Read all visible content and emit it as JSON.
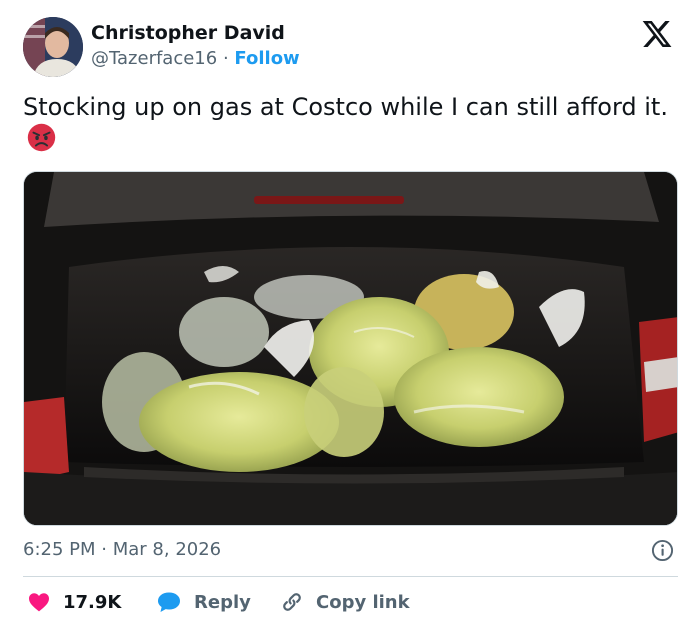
{
  "author": {
    "display_name": "Christopher David",
    "handle": "@Tazerface16",
    "separator": "·",
    "follow_label": "Follow"
  },
  "tweet": {
    "text": "Stocking up on gas at Costco while I can still afford it.",
    "emoji": "angry-face-emoji",
    "time": "6:25 PM",
    "date_separator": "·",
    "date": "Mar 8, 2026"
  },
  "actions": {
    "likes_count": "17.9K",
    "reply_label": "Reply",
    "copy_link_label": "Copy link"
  },
  "icons": {
    "platform": "x-logo-icon",
    "like": "heart-icon",
    "reply": "speech-bubble-icon",
    "copy": "link-icon",
    "info": "info-icon"
  },
  "colors": {
    "text": "#0f1419",
    "secondary": "#536471",
    "accent": "#1d9bf0",
    "like": "#f91880",
    "divider": "#cfd9de"
  }
}
